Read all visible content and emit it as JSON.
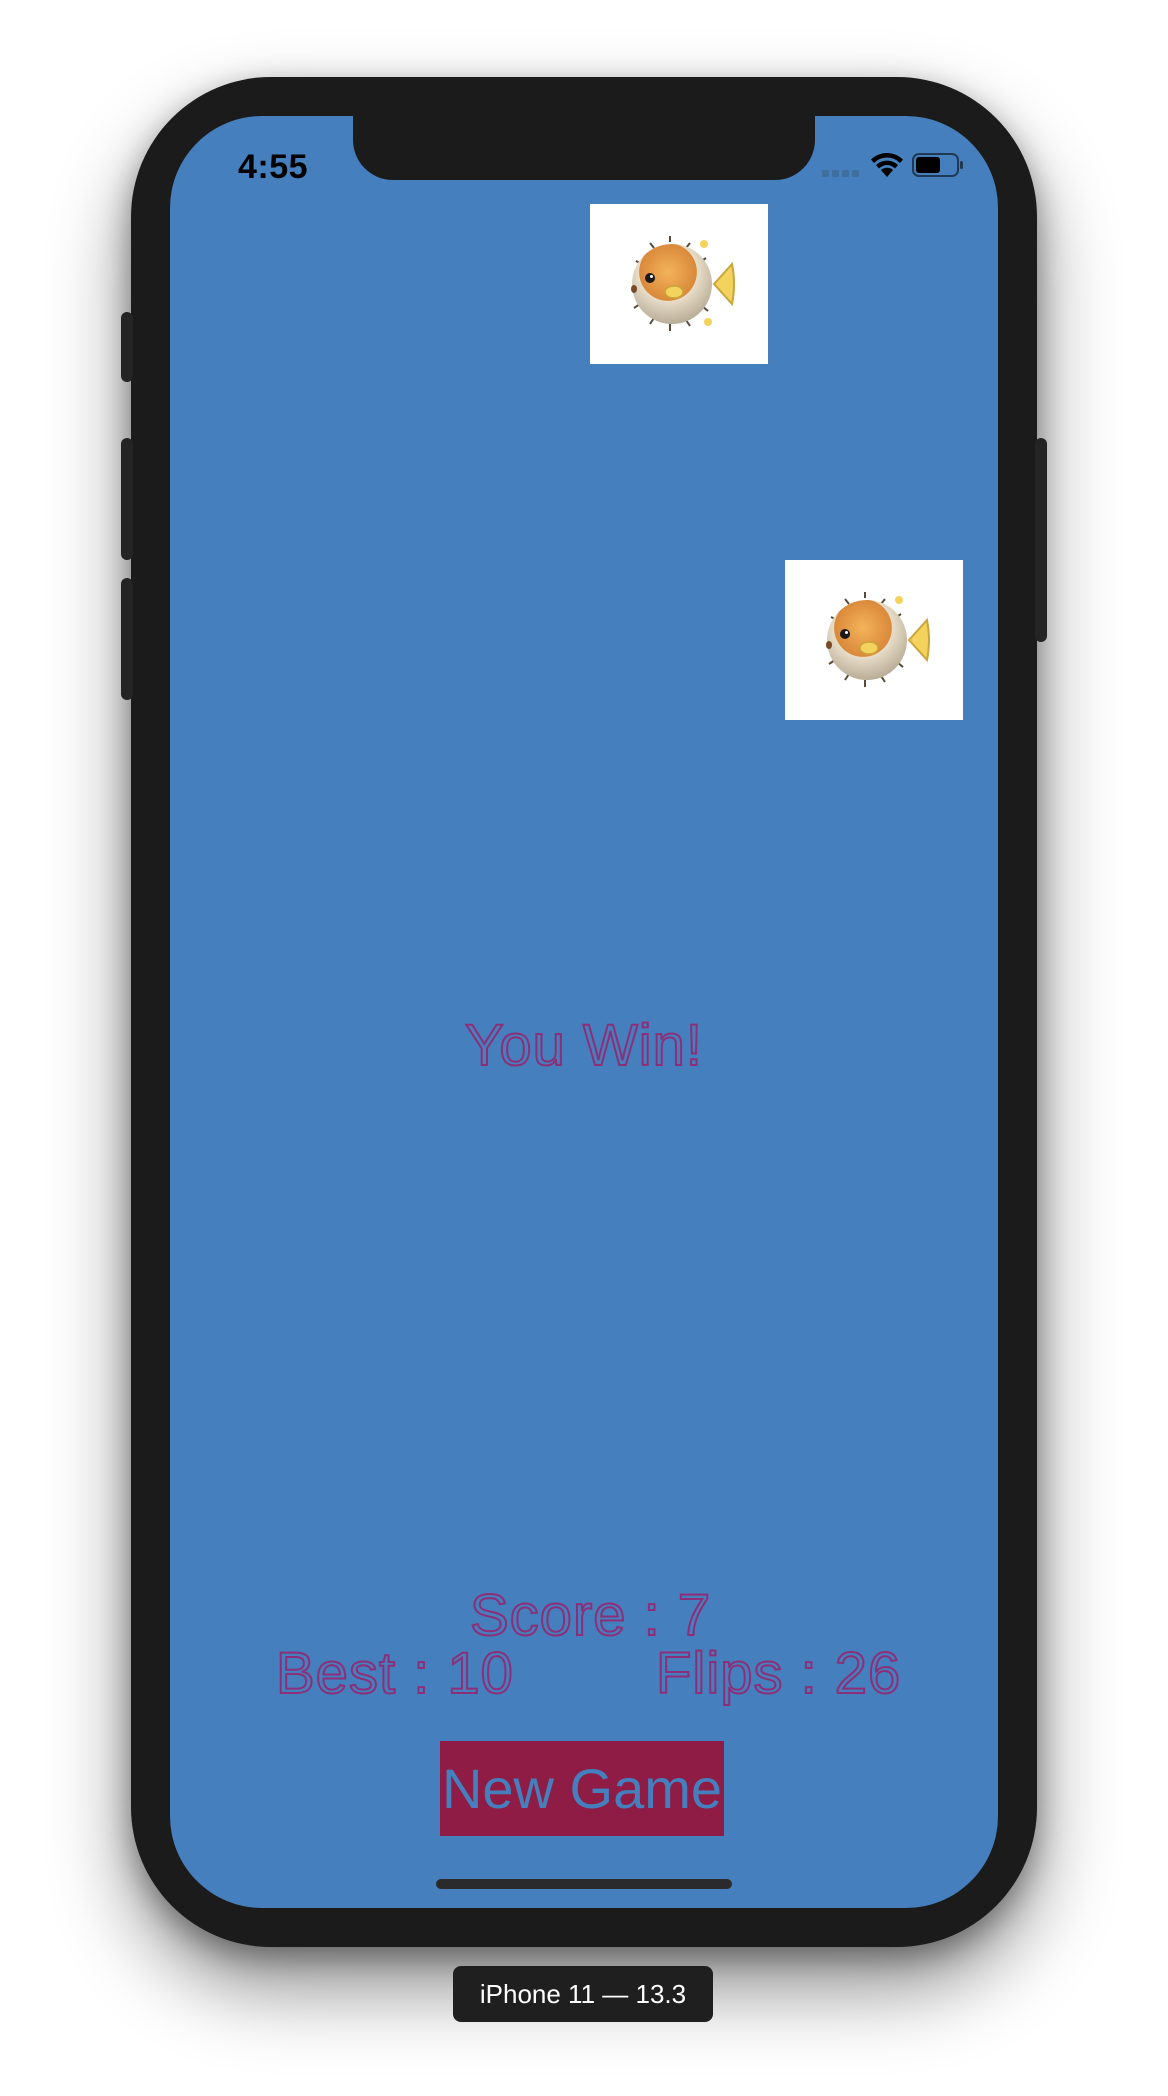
{
  "status_bar": {
    "time": "4:55",
    "icons": [
      "cellular-signal-icon",
      "wifi-icon",
      "battery-icon"
    ]
  },
  "game": {
    "cards": [
      {
        "face": "pufferfish-icon",
        "revealed": true
      },
      {
        "face": "pufferfish-icon",
        "revealed": true
      }
    ],
    "message": "You Win!",
    "score_label": "Score : 7",
    "best_label": "Best : 10",
    "flips_label": "Flips : 26",
    "new_game_label": "New Game"
  },
  "simulator": {
    "device_label": "iPhone 11 — 13.3"
  },
  "colors": {
    "background": "#457fbd",
    "text_outline": "#8c2f78",
    "button_background": "#8e1c45",
    "card_background": "#ffffff"
  }
}
